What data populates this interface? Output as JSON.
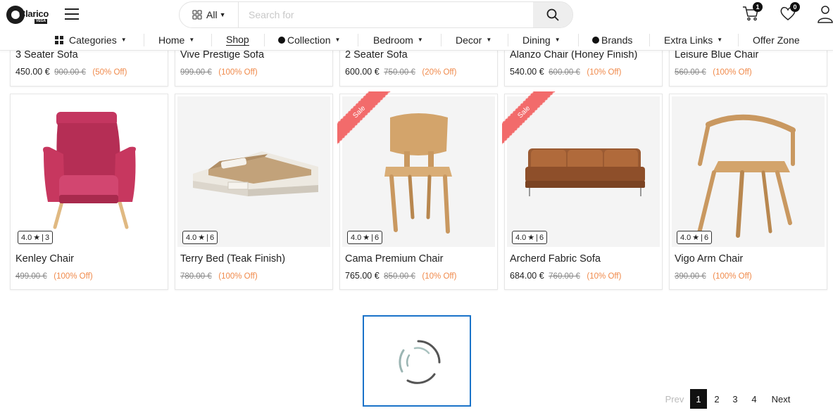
{
  "header": {
    "logo_text": "Clarico",
    "logo_sub": "VEGA",
    "search": {
      "category_label": "All",
      "placeholder": "Search for",
      "value": ""
    },
    "cart_count": "1",
    "wishlist_count": "0"
  },
  "nav": {
    "items": [
      {
        "label": "Categories"
      },
      {
        "label": "Home"
      },
      {
        "label": "Shop"
      },
      {
        "label": "Collection"
      },
      {
        "label": "Bedroom"
      },
      {
        "label": "Decor"
      },
      {
        "label": "Dining"
      },
      {
        "label": "Brands"
      },
      {
        "label": "Extra Links"
      },
      {
        "label": "Offer Zone"
      }
    ]
  },
  "top_products": [
    {
      "name": "3 Seater Sofa",
      "price": "450.00 €",
      "old_price": "900.00 €",
      "discount": "(50% Off)"
    },
    {
      "name": "Vive Prestige Sofa",
      "price": "",
      "old_price": "999.00 €",
      "discount": "(100% Off)"
    },
    {
      "name": "2 Seater Sofa",
      "price": "600.00 €",
      "old_price": "750.00 €",
      "discount": "(20% Off)"
    },
    {
      "name": "Alanzo Chair (Honey Finish)",
      "price": "540.00 €",
      "old_price": "600.00 €",
      "discount": "(10% Off)"
    },
    {
      "name": "Leisure Blue Chair",
      "price": "",
      "old_price": "560.00 €",
      "discount": "(100% Off)"
    }
  ],
  "products": [
    {
      "name": "Kenley Chair",
      "price": "",
      "old_price": "499.00 €",
      "discount": "(100% Off)",
      "rating": "4.0",
      "reviews": "3",
      "sale": false,
      "image": "pink-armchair"
    },
    {
      "name": "Terry Bed (Teak Finish)",
      "price": "",
      "old_price": "780.00 €",
      "discount": "(100% Off)",
      "rating": "4.0",
      "reviews": "6",
      "sale": false,
      "image": "bed"
    },
    {
      "name": "Cama Premium Chair",
      "price": "765.00 €",
      "old_price": "850.00 €",
      "discount": "(10% Off)",
      "rating": "4.0",
      "reviews": "6",
      "sale": true,
      "image": "wooden-chair"
    },
    {
      "name": "Archerd Fabric Sofa",
      "price": "684.00 €",
      "old_price": "760.00 €",
      "discount": "(10% Off)",
      "rating": "4.0",
      "reviews": "6",
      "sale": true,
      "image": "brown-sofa"
    },
    {
      "name": "Vigo Arm Chair",
      "price": "",
      "old_price": "390.00 €",
      "discount": "(100% Off)",
      "rating": "4.0",
      "reviews": "6",
      "sale": false,
      "image": "wooden-arm-chair"
    }
  ],
  "sale_label": "Sale",
  "pagination": {
    "prev": "Prev",
    "pages": [
      "1",
      "2",
      "3",
      "4"
    ],
    "active": "1",
    "next": "Next"
  },
  "colors": {
    "accent_discount": "#f08a4b",
    "sale_ribbon": "#f26b6b",
    "loader_border": "#1a73c9",
    "active_page": "#111111"
  }
}
